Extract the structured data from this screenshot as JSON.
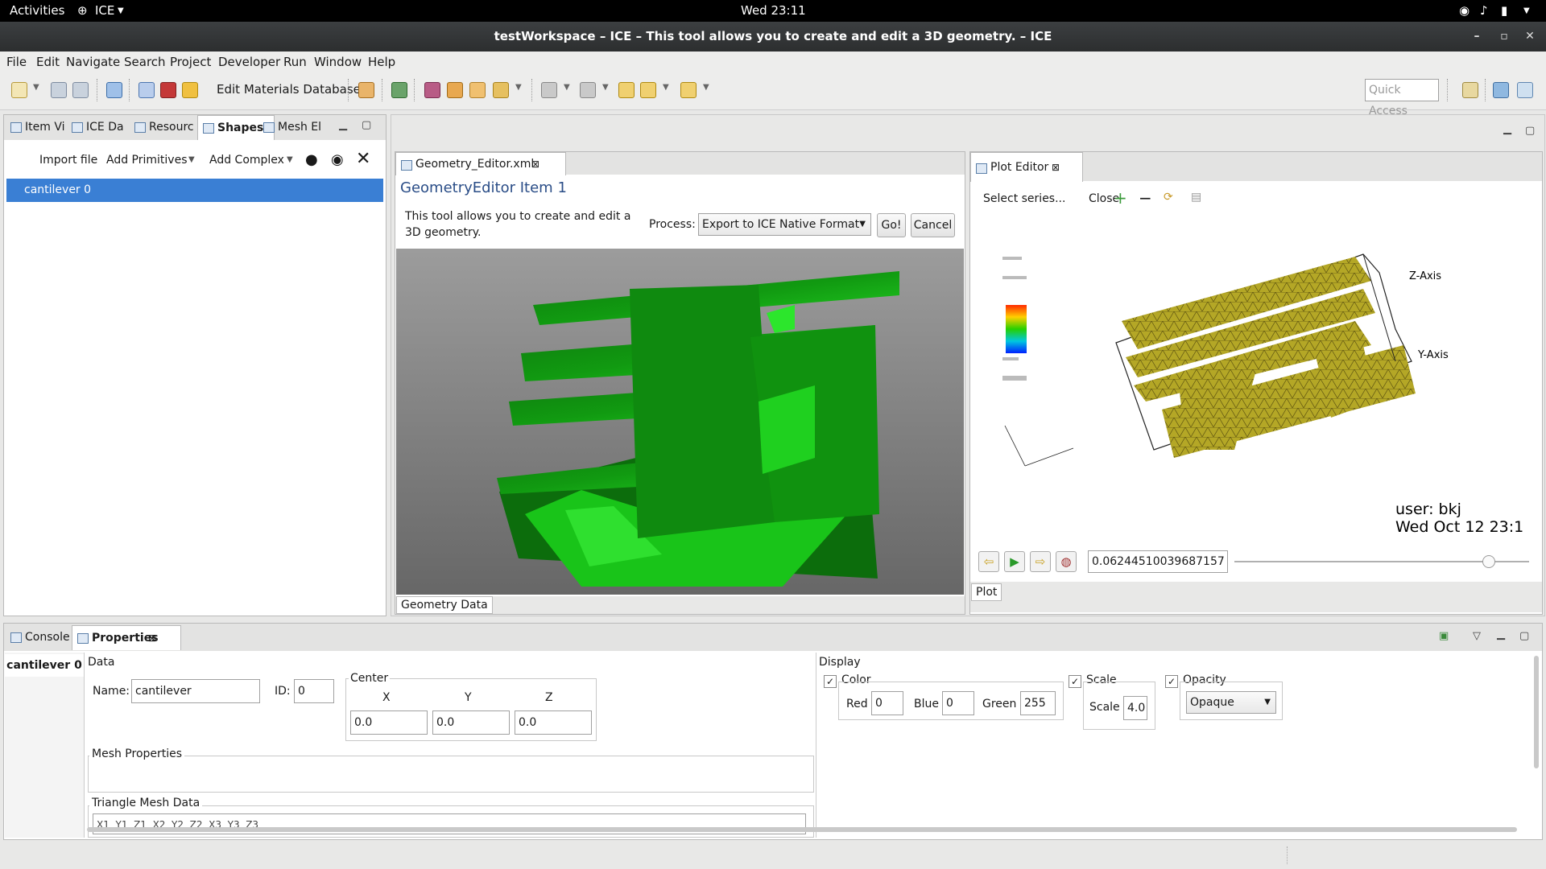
{
  "topbar": {
    "activities": "Activities",
    "app": "ICE",
    "clock": "Wed 23:11"
  },
  "window": {
    "title": "testWorkspace – ICE – This tool allows you to create and edit a 3D geometry. – ICE"
  },
  "menu": [
    "File",
    "Edit",
    "Navigate",
    "Search",
    "Project",
    "Developer",
    "Run",
    "Window",
    "Help"
  ],
  "toolbar": {
    "edit_materials": "Edit Materials Database",
    "quick_access": "Quick Access"
  },
  "left_panel": {
    "tabs": [
      "Item Vi",
      "ICE Da",
      "Resourc",
      "Shapes",
      "Mesh El"
    ],
    "active_tab": "Shapes",
    "actions": {
      "import": "Import file",
      "primitives": "Add Primitives",
      "complex": "Add Complex"
    },
    "tree_items": [
      "cantilever 0"
    ]
  },
  "editor": {
    "tab": "Geometry_Editor.xml",
    "heading": "GeometryEditor Item 1",
    "description": "This tool allows you to create and edit a 3D geometry.",
    "process_label": "Process:",
    "process_value": "Export to ICE Native Format",
    "go": "Go!",
    "cancel": "Cancel",
    "bottom_tab": "Geometry Data",
    "colors": {
      "bg_top": "#9a9a9a",
      "bg_bottom": "#6a6a6a",
      "shape": "#1fb81f"
    }
  },
  "plot": {
    "tab": "Plot Editor",
    "select_series": "Select series...",
    "close": "Close",
    "axis_z": "Z-Axis",
    "axis_y": "Y-Axis",
    "user": "user: bkj",
    "date": "Wed Oct 12 23:1",
    "time_value": "0.06244510039687157",
    "time_fraction": 0.86,
    "bottom_tab": "Plot",
    "colors": {
      "mesh": "#b4a726"
    }
  },
  "bottom": {
    "tabs": [
      "Console",
      "Properties"
    ],
    "active_tab": "Properties",
    "item": "cantilever 0",
    "data_label": "Data",
    "name_label": "Name:",
    "name_value": "cantilever",
    "id_label": "ID:",
    "id_value": "0",
    "center_label": "Center",
    "xyz": [
      "X",
      "Y",
      "Z"
    ],
    "center_values": [
      "0.0",
      "0.0",
      "0.0"
    ],
    "mesh_props": "Mesh Properties",
    "tri_mesh": "Triangle Mesh Data",
    "tri_headers": "X1  Y1  Z1  X2  Y2  Z2  X3  Y3  Z3",
    "display_label": "Display",
    "color_label": "Color",
    "red_label": "Red",
    "red": "0",
    "blue_label": "Blue",
    "blue": "0",
    "green_label": "Green",
    "green": "255",
    "scale_label": "Scale",
    "scale_inner": "Scale",
    "scale": "4.0",
    "opacity_label": "Opacity",
    "opacity": "Opaque"
  }
}
